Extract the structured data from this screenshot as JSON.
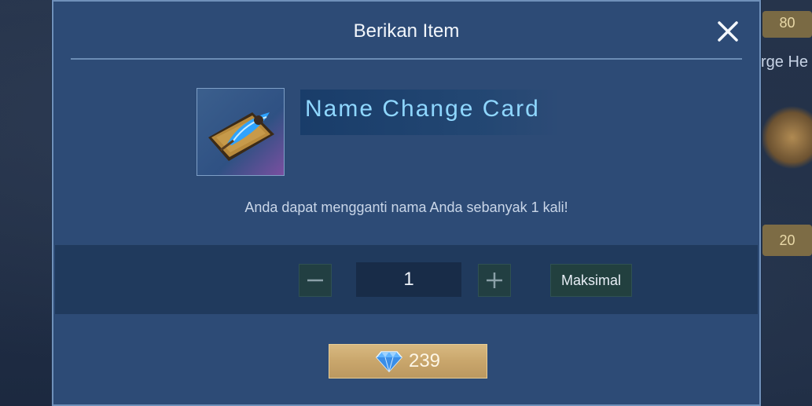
{
  "background": {
    "chip_top": "80",
    "label": "rge He",
    "chip_mid": "20"
  },
  "dialog": {
    "title": "Berikan Item",
    "close_icon": "close-icon"
  },
  "item": {
    "name": "Name Change Card",
    "description": "Anda dapat mengganti nama Anda sebanyak 1 kali!",
    "icon": "name-change-card-icon"
  },
  "quantity": {
    "value": "1",
    "minus_icon": "minus-icon",
    "plus_icon": "plus-icon",
    "max_label": "Maksimal"
  },
  "purchase": {
    "price": "239",
    "currency_icon": "diamond-icon"
  },
  "colors": {
    "dialog_bg": "#2d4b76",
    "item_name": "#8fd7ff",
    "buy_button": "#c9a66c"
  }
}
